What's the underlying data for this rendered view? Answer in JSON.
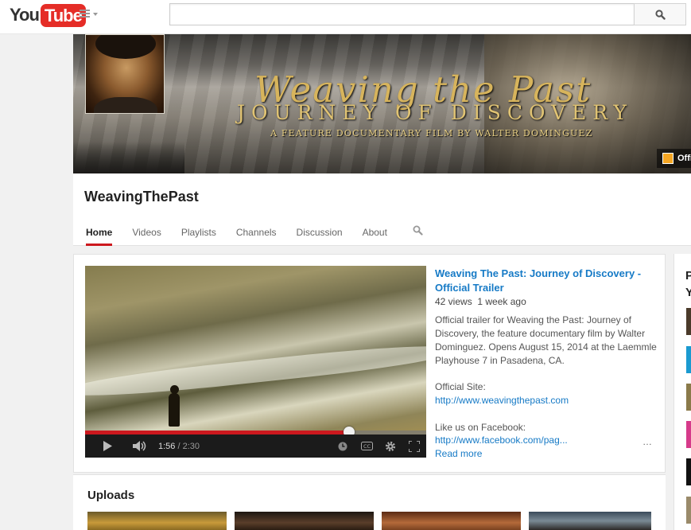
{
  "masthead": {
    "logo_you": "You",
    "logo_tube": "Tube",
    "search_placeholder": "",
    "search_value": ""
  },
  "banner": {
    "title_line1": "Weaving the Past",
    "title_line2": "JOURNEY OF DISCOVERY",
    "tagline": "A FEATURE DOCUMENTARY FILM BY WALTER DOMINGUEZ",
    "link_text": "Official Site"
  },
  "channel": {
    "name": "WeavingThePast",
    "tabs": [
      {
        "label": "Home",
        "active": true
      },
      {
        "label": "Videos",
        "active": false
      },
      {
        "label": "Playlists",
        "active": false
      },
      {
        "label": "Channels",
        "active": false
      },
      {
        "label": "Discussion",
        "active": false
      },
      {
        "label": "About",
        "active": false
      }
    ]
  },
  "featured": {
    "title": "Weaving The Past: Journey of Discovery - Official Trailer",
    "views": "42 views",
    "age": "1 week ago",
    "description": "Official trailer for Weaving the Past: Journey of Discovery, the feature documentary film by Walter Dominguez. Opens August 15, 2014 at the Laemmle Playhouse 7 in Pasadena, CA.",
    "official_site_label": "Official Site:",
    "official_site_url": "http://www.weavingthepast.com",
    "facebook_label": "Like us on Facebook:",
    "facebook_url": "http://www.facebook.com/pag...",
    "ellipsis": "…",
    "read_more": "Read more",
    "player": {
      "current_time": "1:56",
      "duration": "/ 2:30",
      "progress_fraction": 0.773
    }
  },
  "uploads": {
    "heading": "Uploads"
  },
  "sidebar": {
    "heading_fragment": "P\nY"
  },
  "colors": {
    "accent_red": "#cc181e",
    "link_blue": "#167ac6"
  }
}
